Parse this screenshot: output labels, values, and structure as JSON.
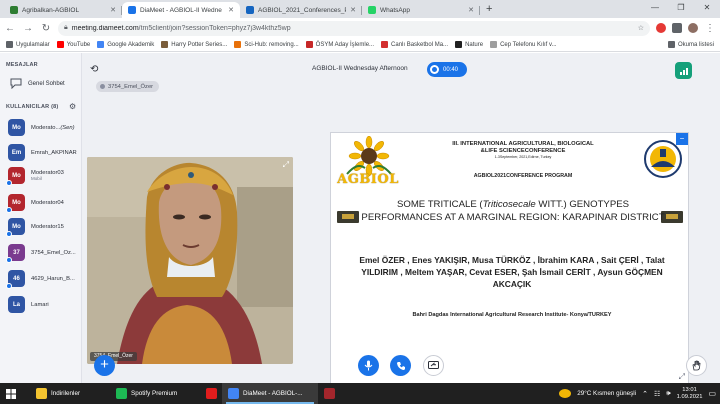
{
  "browser": {
    "tabs": [
      {
        "label": "Agribalkan-AGBIOL",
        "active": false,
        "color": "#2e7d32"
      },
      {
        "label": "DiaMeet - AGBIOL-II Wedne",
        "active": true,
        "color": "#1a73e8"
      },
      {
        "label": "AGBIOL_2021_Conferences_Prog",
        "active": false,
        "color": "#1565c0"
      },
      {
        "label": "WhatsApp",
        "active": false,
        "color": "#25d366"
      }
    ],
    "new_tab": "+",
    "window_controls": [
      "—",
      "❐",
      "✕"
    ],
    "url_main": "meeting.diameet.com",
    "url_rest": "/tm5client/join?sessionToken=phyz7j3w4kthz5wp",
    "bookmarks": [
      {
        "label": "Uygulamalar",
        "color": "#5f6368"
      },
      {
        "label": "YouTube",
        "color": "#ff0000"
      },
      {
        "label": "Google Akademik",
        "color": "#4285f4"
      },
      {
        "label": "Harry Potter Series...",
        "color": "#7b5e3b"
      },
      {
        "label": "Sci-Hub: removing...",
        "color": "#e8710a"
      },
      {
        "label": "ÖSYM Aday İşlemle...",
        "color": "#c62828"
      },
      {
        "label": "Canlı Basketbol Ma...",
        "color": "#d32f2f"
      },
      {
        "label": "Nature",
        "color": "#212121"
      },
      {
        "label": "Cep Telefonu Kılıf v...",
        "color": "#9e9e9e"
      }
    ],
    "reading_list": "Okuma listesi"
  },
  "sidebar": {
    "messages_header": "MESAJLAR",
    "general_chat": "Genel Sohbet",
    "users_header": "KULLANICILAR (8)",
    "users": [
      {
        "initials": "Mo",
        "name": "Moderato...",
        "suffix": "(Sen)",
        "sub": "",
        "color": "#2f55a4",
        "dot": false
      },
      {
        "initials": "Em",
        "name": "Emrah_AKPINAR",
        "suffix": "",
        "sub": "",
        "color": "#2f55a4",
        "dot": false
      },
      {
        "initials": "Mo",
        "name": "Moderator03",
        "suffix": "",
        "sub": "Mobil",
        "color": "#b3262e",
        "dot": true
      },
      {
        "initials": "Mo",
        "name": "Moderator04",
        "suffix": "",
        "sub": "",
        "color": "#b3262e",
        "dot": true
      },
      {
        "initials": "Mo",
        "name": "Moderator15",
        "suffix": "",
        "sub": "",
        "color": "#2f55a4",
        "dot": true
      },
      {
        "initials": "37",
        "name": "3754_Emel_Öz...",
        "suffix": "",
        "sub": "",
        "color": "#7a3a8f",
        "dot": true
      },
      {
        "initials": "46",
        "name": "4629_Harun_B...",
        "suffix": "",
        "sub": "",
        "color": "#2f55a4",
        "dot": true
      },
      {
        "initials": "La",
        "name": "Lamari",
        "suffix": "",
        "sub": "",
        "color": "#2f55a4",
        "dot": false
      }
    ]
  },
  "meeting": {
    "title": "AGBIOL-II Wednesday Afternoon",
    "timer": "00:40",
    "presenter_pill": "3754_Emel_Özer",
    "video_label": "3754_Emel_Özer"
  },
  "slide": {
    "conf_line1": "III. INTERNATIONAL AGRICULTURAL, BIOLOGICAL",
    "conf_line2": "&LIFE SCIENCECONFERENCE",
    "conf_line3": "1-3September, 2021,Edirne, Turkey",
    "program": "AGBIOL2021CONFERENCE PROGRAM",
    "logo_text": "AGBIOL",
    "title_pre": "SOME TRITICALE (",
    "title_italic": "Triticosecale",
    "title_post": " WITT.) GENOTYPES PERFORMANCES AT A MARGINAL REGION: KARAPINAR DISTRICT",
    "authors": "Emel ÖZER , Enes YAKIŞIR, Musa TÜRKÖZ , İbrahim KARA , Sait ÇERİ , Talat YILDIRIM , Meltem YAŞAR, Cevat ESER, Şah İsmail CERİT , Aysun GÖÇMEN AKCAÇIK",
    "affiliation": "Bahri Dagdas International Agricultural Research Institute- Konya/TURKEY"
  },
  "taskbar": {
    "items": [
      {
        "label": "İndirilenler",
        "color": "#f4c430",
        "active": false
      },
      {
        "label": "Spotify Premium",
        "color": "#1db954",
        "active": false
      },
      {
        "label": "",
        "color": "#e11d1d",
        "active": false
      },
      {
        "label": "DiaMeet - AGBIOL-...",
        "color": "#4285f4",
        "active": true
      },
      {
        "label": "",
        "color": "#a4262c",
        "active": false
      }
    ],
    "weather": "29°C  Kısmen güneşli",
    "time": "13:01",
    "date": "1.09.2021"
  },
  "colors": {
    "accent": "#1a73e8",
    "agbiol_yellow": "#f2b705"
  }
}
